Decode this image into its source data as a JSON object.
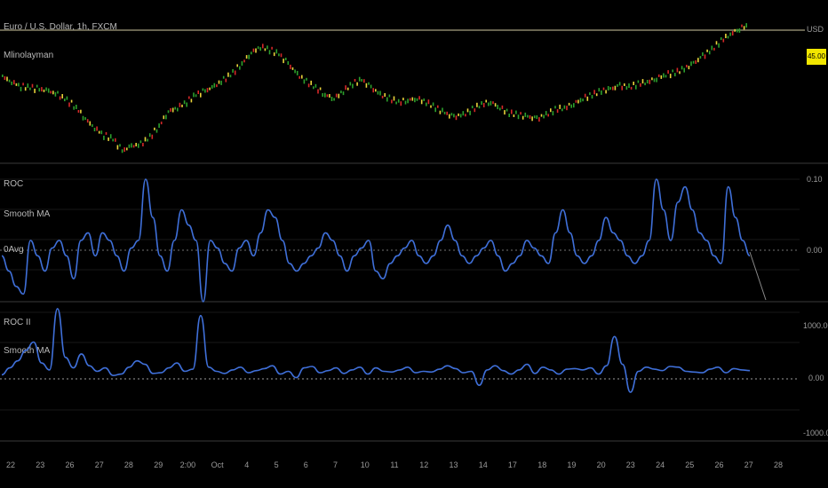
{
  "chart_data": [
    {
      "type": "line",
      "panel": "price",
      "title": "Euro / U.S. Dollar, 1h, FXCM",
      "subtitle": "Mlinolayman",
      "y_axis_labels": [
        "USD"
      ],
      "last_value_badge": "45.00",
      "candle_colors": {
        "up": "#2ca02c",
        "down": "#d62728",
        "neutral": "#e8d23a"
      },
      "series": [
        {
          "values": [
            84,
            90,
            95,
            96,
            98,
            100,
            104,
            110,
            118,
            130,
            140,
            148,
            152,
            165,
            160,
            158,
            150,
            138,
            122,
            118,
            112,
            104,
            100,
            95,
            88,
            80,
            70,
            58,
            52,
            55,
            60,
            70,
            82,
            90,
            96,
            104,
            108,
            100,
            92,
            88,
            96,
            104,
            108,
            112,
            110,
            108,
            112,
            118,
            124,
            128,
            126,
            120,
            114,
            112,
            118,
            124,
            126,
            128,
            130,
            126,
            120,
            118,
            114,
            108,
            104,
            100,
            98,
            94,
            96,
            92,
            90,
            86,
            82,
            80,
            76,
            70,
            62,
            55,
            45,
            38,
            32,
            28
          ]
        }
      ],
      "hline_y": 0.8
    },
    {
      "type": "line",
      "panel": "roc",
      "legend": [
        "ROC",
        "Smooth MA",
        "0Avg"
      ],
      "y_ticks": [
        "0.10",
        "0.00"
      ],
      "ylim": [
        -0.06,
        0.1
      ],
      "series": [
        {
          "color": "#3f6fd8",
          "values": [
            0.0,
            -0.02,
            -0.04,
            -0.05,
            0.02,
            0.0,
            -0.02,
            0.01,
            0.02,
            0.0,
            -0.03,
            0.02,
            0.03,
            0.0,
            0.03,
            0.02,
            0.0,
            -0.02,
            0.01,
            0.02,
            0.1,
            0.05,
            0.0,
            -0.02,
            0.02,
            0.06,
            0.04,
            0.02,
            -0.06,
            0.02,
            0.01,
            -0.01,
            -0.02,
            0.01,
            0.02,
            0.0,
            0.03,
            0.06,
            0.05,
            0.02,
            -0.01,
            -0.02,
            -0.01,
            0.0,
            0.01,
            0.03,
            0.02,
            0.0,
            -0.02,
            0.0,
            0.01,
            0.02,
            -0.02,
            -0.03,
            -0.01,
            0.0,
            0.01,
            0.02,
            0.0,
            -0.01,
            0.0,
            0.02,
            0.04,
            0.02,
            0.0,
            -0.01,
            0.0,
            0.01,
            0.02,
            0.0,
            -0.02,
            -0.01,
            0.0,
            0.02,
            0.01,
            0.0,
            -0.01,
            0.03,
            0.06,
            0.03,
            0.0,
            -0.01,
            0.0,
            0.02,
            0.05,
            0.03,
            0.02,
            0.0,
            -0.01,
            0.0,
            0.02,
            0.1,
            0.06,
            0.02,
            0.07,
            0.09,
            0.06,
            0.03,
            0.02,
            0.0,
            -0.01,
            0.09,
            0.05,
            0.02,
            0.0
          ]
        }
      ]
    },
    {
      "type": "line",
      "panel": "roc_ii",
      "legend": [
        "ROC II",
        "Smooth MA"
      ],
      "y_ticks": [
        "1000.00",
        "0.00",
        "-1000.00"
      ],
      "ylim": [
        -1000,
        1000
      ],
      "series": [
        {
          "color": "#3f6fd8",
          "values": [
            -50,
            50,
            150,
            300,
            420,
            120,
            20,
            900,
            200,
            50,
            250,
            80,
            0,
            50,
            -60,
            -40,
            60,
            150,
            100,
            -30,
            -20,
            50,
            120,
            0,
            30,
            800,
            60,
            0,
            -30,
            20,
            60,
            -20,
            10,
            40,
            80,
            -40,
            0,
            -90,
            50,
            70,
            -20,
            10,
            50,
            -30,
            20,
            60,
            -40,
            50,
            0,
            -10,
            20,
            60,
            -20,
            0,
            -10,
            30,
            80,
            40,
            -20,
            0,
            -200,
            20,
            80,
            10,
            -40,
            20,
            100,
            -30,
            60,
            20,
            -40,
            30,
            40,
            20,
            50,
            -40,
            80,
            500,
            100,
            -300,
            0,
            60,
            30,
            10,
            70,
            60,
            0,
            -10,
            -20,
            30,
            60,
            -20,
            40,
            20,
            10
          ]
        }
      ]
    }
  ],
  "x_axis": {
    "ticks": [
      "22",
      "23",
      "26",
      "27",
      "28",
      "29",
      "2:00",
      "Oct",
      "4",
      "5",
      "6",
      "7",
      "10",
      "11",
      "12",
      "13",
      "14",
      "17",
      "18",
      "19",
      "20",
      "23",
      "24",
      "25",
      "26",
      "27",
      "28"
    ]
  }
}
